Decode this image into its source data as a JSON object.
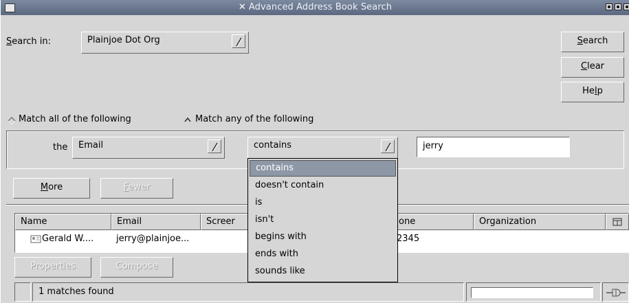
{
  "window": {
    "title": "Advanced Address Book Search"
  },
  "search_in": {
    "label": "Search in:",
    "accesskey_prefix": "S",
    "label_rest": "earch in:",
    "value": "Plainjoe Dot Org"
  },
  "buttons": {
    "search": {
      "pre": "",
      "key": "S",
      "post": "earch"
    },
    "clear": {
      "pre": "",
      "key": "C",
      "post": "lear"
    },
    "help": {
      "pre": "He",
      "key": "l",
      "post": "p"
    },
    "more": {
      "pre": "",
      "key": "M",
      "post": "ore"
    },
    "fewer": {
      "pre": "",
      "key": "F",
      "post": "ewer"
    },
    "properties": "Properties",
    "compose": "Compose"
  },
  "match": {
    "all_label": "Match all of the following",
    "any_label": "Match any of the following",
    "selected": "any"
  },
  "criterion": {
    "prefix": "the",
    "field": "Email",
    "operator": "contains",
    "value": "jerry"
  },
  "operator_menu": {
    "items": [
      "contains",
      "doesn't contain",
      "is",
      "isn't",
      "begins with",
      "ends with",
      "sounds like"
    ],
    "selected_index": 0
  },
  "results": {
    "columns": [
      "Name",
      "Email",
      "Screen",
      "Phone",
      "Organization"
    ],
    "phone_visible_fragment": "one",
    "screen_visible_fragment": "Screer",
    "rows": [
      {
        "name": "Gerald W....",
        "email": "jerry@plainjoe...",
        "screen": "",
        "phone": "2345",
        "organization": ""
      }
    ]
  },
  "status": {
    "text": "1 matches found"
  },
  "colors": {
    "titlebar": "#6b7890",
    "selection": "#8e97a6",
    "background": "#d6d6d6"
  }
}
